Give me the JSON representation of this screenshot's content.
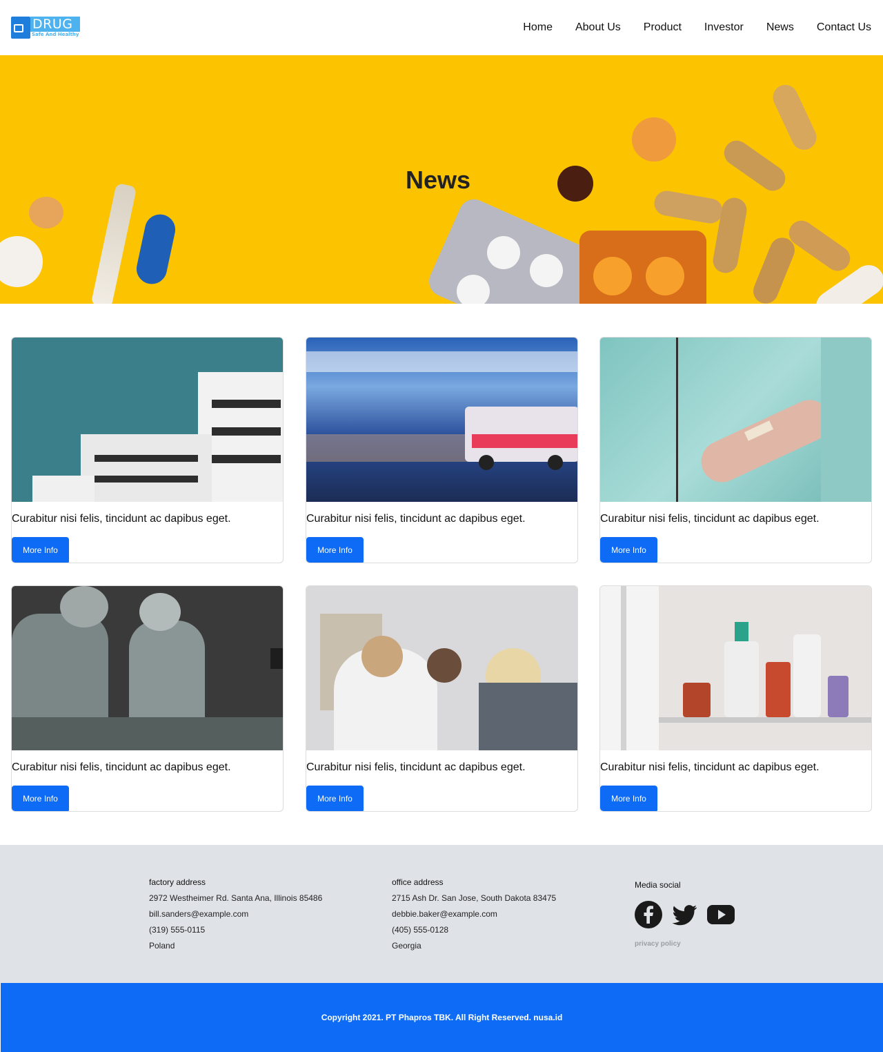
{
  "header": {
    "logo": {
      "word": "DRUG",
      "tagline": "Safe And Healthy"
    },
    "nav": [
      "Home",
      "About Us",
      "Product",
      "Investor",
      "News",
      "Contact Us"
    ]
  },
  "hero": {
    "title": "News"
  },
  "cards": [
    {
      "image": "white-building-photo",
      "text": "Curabitur nisi felis, tincidunt ac dapibus eget.",
      "button": "More Info"
    },
    {
      "image": "ambulance-photo",
      "text": "Curabitur nisi felis, tincidunt ac dapibus eget.",
      "button": "More Info"
    },
    {
      "image": "iv-drip-hand-photo",
      "text": "Curabitur nisi felis, tincidunt ac dapibus eget.",
      "button": "More Info"
    },
    {
      "image": "surgeons-photo",
      "text": "Curabitur nisi felis, tincidunt ac dapibus eget.",
      "button": "More Info"
    },
    {
      "image": "pharmacy-counter-photo",
      "text": "Curabitur nisi felis, tincidunt ac dapibus eget.",
      "button": "More Info"
    },
    {
      "image": "medicine-bottles-photo",
      "text": "Curabitur nisi felis, tincidunt ac dapibus eget.",
      "button": "More Info"
    }
  ],
  "footer": {
    "factory": {
      "title": "factory address",
      "address": "2972 Westheimer Rd. Santa Ana, Illinois 85486",
      "email": "bill.sanders@example.com",
      "phone": "(319) 555-0115",
      "country": "Poland"
    },
    "office": {
      "title": "office address",
      "address": "2715 Ash Dr. San Jose, South Dakota 83475",
      "email": "debbie.baker@example.com",
      "phone": "(405) 555-0128",
      "country": "Georgia"
    },
    "social": {
      "title": "Media social",
      "icons": [
        "facebook-icon",
        "twitter-icon",
        "youtube-icon"
      ],
      "privacy": "privacy policy"
    },
    "copyright": "Copyright 2021. PT Phapros TBK. All Right Reserved. nusa.id"
  },
  "colors": {
    "primary": "#0e6bf5",
    "hero": "#fcc400",
    "footer": "#dfe2e6"
  }
}
